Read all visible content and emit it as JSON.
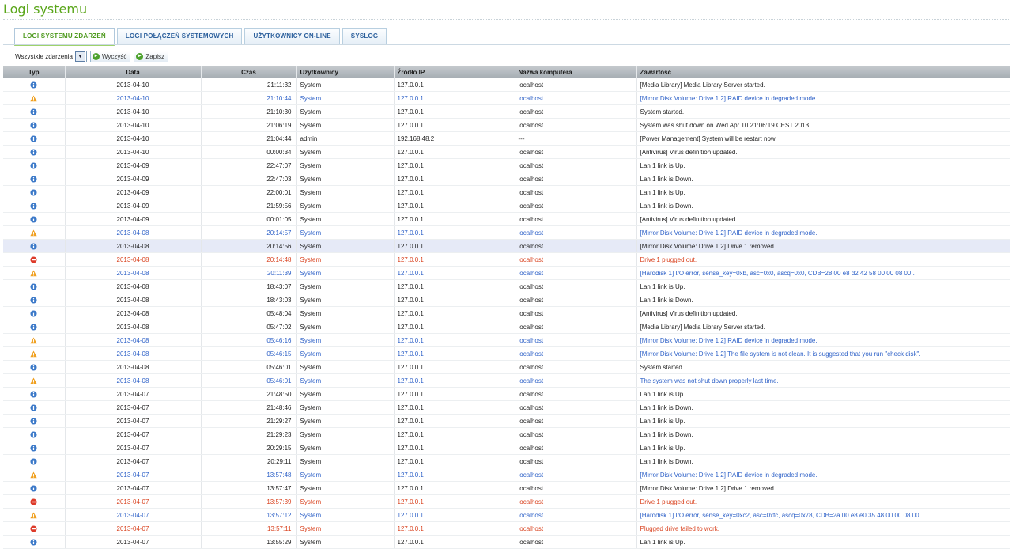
{
  "page": {
    "title": "Logi systemu"
  },
  "tabs": [
    {
      "label": "LOGI SYSTEMU ZDARZEŃ",
      "active": true
    },
    {
      "label": "LOGI POŁĄCZEŃ SYSTEMOWYCH",
      "active": false
    },
    {
      "label": "UŻYTKOWNICY ON-LINE",
      "active": false
    },
    {
      "label": "SYSLOG",
      "active": false
    }
  ],
  "toolbar": {
    "filter_value": "Wszystkie zdarzenia",
    "clear_label": "Wyczyść",
    "save_label": "Zapisz"
  },
  "table": {
    "columns": {
      "type": "Typ",
      "date": "Data",
      "time": "Czas",
      "users": "Użytkownicy",
      "source_ip": "Źródło IP",
      "computer": "Nazwa komputera",
      "content": "Zawartość"
    },
    "rows": [
      {
        "type": "info",
        "date": "2013-04-10",
        "time": "21:11:32",
        "user": "System",
        "ip": "127.0.0.1",
        "computer": "localhost",
        "content": "[Media Library] Media Library Server started."
      },
      {
        "type": "warning",
        "date": "2013-04-10",
        "time": "21:10:44",
        "user": "System",
        "ip": "127.0.0.1",
        "computer": "localhost",
        "content": "[Mirror Disk Volume: Drive 1 2] RAID device in degraded mode."
      },
      {
        "type": "info",
        "date": "2013-04-10",
        "time": "21:10:30",
        "user": "System",
        "ip": "127.0.0.1",
        "computer": "localhost",
        "content": "System started."
      },
      {
        "type": "info",
        "date": "2013-04-10",
        "time": "21:06:19",
        "user": "System",
        "ip": "127.0.0.1",
        "computer": "localhost",
        "content": "System was shut down on Wed Apr 10 21:06:19 CEST 2013."
      },
      {
        "type": "info",
        "date": "2013-04-10",
        "time": "21:04:44",
        "user": "admin",
        "ip": "192.168.48.2",
        "computer": "---",
        "content": "[Power Management] System will be restart now."
      },
      {
        "type": "info",
        "date": "2013-04-10",
        "time": "00:00:34",
        "user": "System",
        "ip": "127.0.0.1",
        "computer": "localhost",
        "content": "[Antivirus] Virus definition updated."
      },
      {
        "type": "info",
        "date": "2013-04-09",
        "time": "22:47:07",
        "user": "System",
        "ip": "127.0.0.1",
        "computer": "localhost",
        "content": "Lan 1 link is Up."
      },
      {
        "type": "info",
        "date": "2013-04-09",
        "time": "22:47:03",
        "user": "System",
        "ip": "127.0.0.1",
        "computer": "localhost",
        "content": "Lan 1 link is Down."
      },
      {
        "type": "info",
        "date": "2013-04-09",
        "time": "22:00:01",
        "user": "System",
        "ip": "127.0.0.1",
        "computer": "localhost",
        "content": "Lan 1 link is Up."
      },
      {
        "type": "info",
        "date": "2013-04-09",
        "time": "21:59:56",
        "user": "System",
        "ip": "127.0.0.1",
        "computer": "localhost",
        "content": "Lan 1 link is Down."
      },
      {
        "type": "info",
        "date": "2013-04-09",
        "time": "00:01:05",
        "user": "System",
        "ip": "127.0.0.1",
        "computer": "localhost",
        "content": "[Antivirus] Virus definition updated."
      },
      {
        "type": "warning",
        "date": "2013-04-08",
        "time": "20:14:57",
        "user": "System",
        "ip": "127.0.0.1",
        "computer": "localhost",
        "content": "[Mirror Disk Volume: Drive 1 2] RAID device in degraded mode."
      },
      {
        "type": "info",
        "date": "2013-04-08",
        "time": "20:14:56",
        "user": "System",
        "ip": "127.0.0.1",
        "computer": "localhost",
        "content": "[Mirror Disk Volume: Drive 1 2] Drive 1 removed.",
        "selected": true
      },
      {
        "type": "error",
        "date": "2013-04-08",
        "time": "20:14:48",
        "user": "System",
        "ip": "127.0.0.1",
        "computer": "localhost",
        "content": "Drive 1 plugged out."
      },
      {
        "type": "warning",
        "date": "2013-04-08",
        "time": "20:11:39",
        "user": "System",
        "ip": "127.0.0.1",
        "computer": "localhost",
        "content": "[Harddisk 1] I/O error, sense_key=0xb, asc=0x0, ascq=0x0, CDB=28 00 e8 d2 42 58 00 00 08 00 ."
      },
      {
        "type": "info",
        "date": "2013-04-08",
        "time": "18:43:07",
        "user": "System",
        "ip": "127.0.0.1",
        "computer": "localhost",
        "content": "Lan 1 link is Up."
      },
      {
        "type": "info",
        "date": "2013-04-08",
        "time": "18:43:03",
        "user": "System",
        "ip": "127.0.0.1",
        "computer": "localhost",
        "content": "Lan 1 link is Down."
      },
      {
        "type": "info",
        "date": "2013-04-08",
        "time": "05:48:04",
        "user": "System",
        "ip": "127.0.0.1",
        "computer": "localhost",
        "content": "[Antivirus] Virus definition updated."
      },
      {
        "type": "info",
        "date": "2013-04-08",
        "time": "05:47:02",
        "user": "System",
        "ip": "127.0.0.1",
        "computer": "localhost",
        "content": "[Media Library] Media Library Server started."
      },
      {
        "type": "warning",
        "date": "2013-04-08",
        "time": "05:46:16",
        "user": "System",
        "ip": "127.0.0.1",
        "computer": "localhost",
        "content": "[Mirror Disk Volume: Drive 1 2] RAID device in degraded mode."
      },
      {
        "type": "warning",
        "date": "2013-04-08",
        "time": "05:46:15",
        "user": "System",
        "ip": "127.0.0.1",
        "computer": "localhost",
        "content": "[Mirror Disk Volume: Drive 1 2] The file system is not clean. It is suggested that you run \"check disk\"."
      },
      {
        "type": "info",
        "date": "2013-04-08",
        "time": "05:46:01",
        "user": "System",
        "ip": "127.0.0.1",
        "computer": "localhost",
        "content": "System started."
      },
      {
        "type": "warning",
        "date": "2013-04-08",
        "time": "05:46:01",
        "user": "System",
        "ip": "127.0.0.1",
        "computer": "localhost",
        "content": "The system was not shut down properly last time."
      },
      {
        "type": "info",
        "date": "2013-04-07",
        "time": "21:48:50",
        "user": "System",
        "ip": "127.0.0.1",
        "computer": "localhost",
        "content": "Lan 1 link is Up."
      },
      {
        "type": "info",
        "date": "2013-04-07",
        "time": "21:48:46",
        "user": "System",
        "ip": "127.0.0.1",
        "computer": "localhost",
        "content": "Lan 1 link is Down."
      },
      {
        "type": "info",
        "date": "2013-04-07",
        "time": "21:29:27",
        "user": "System",
        "ip": "127.0.0.1",
        "computer": "localhost",
        "content": "Lan 1 link is Up."
      },
      {
        "type": "info",
        "date": "2013-04-07",
        "time": "21:29:23",
        "user": "System",
        "ip": "127.0.0.1",
        "computer": "localhost",
        "content": "Lan 1 link is Down."
      },
      {
        "type": "info",
        "date": "2013-04-07",
        "time": "20:29:15",
        "user": "System",
        "ip": "127.0.0.1",
        "computer": "localhost",
        "content": "Lan 1 link is Up."
      },
      {
        "type": "info",
        "date": "2013-04-07",
        "time": "20:29:11",
        "user": "System",
        "ip": "127.0.0.1",
        "computer": "localhost",
        "content": "Lan 1 link is Down."
      },
      {
        "type": "warning",
        "date": "2013-04-07",
        "time": "13:57:48",
        "user": "System",
        "ip": "127.0.0.1",
        "computer": "localhost",
        "content": "[Mirror Disk Volume: Drive 1 2] RAID device in degraded mode."
      },
      {
        "type": "info",
        "date": "2013-04-07",
        "time": "13:57:47",
        "user": "System",
        "ip": "127.0.0.1",
        "computer": "localhost",
        "content": "[Mirror Disk Volume: Drive 1 2] Drive 1 removed."
      },
      {
        "type": "error",
        "date": "2013-04-07",
        "time": "13:57:39",
        "user": "System",
        "ip": "127.0.0.1",
        "computer": "localhost",
        "content": "Drive 1 plugged out."
      },
      {
        "type": "warning",
        "date": "2013-04-07",
        "time": "13:57:12",
        "user": "System",
        "ip": "127.0.0.1",
        "computer": "localhost",
        "content": "[Harddisk 1] I/O error, sense_key=0xc2, asc=0xfc, ascq=0x78, CDB=2a 00 e8 e0 35 48 00 00 08 00 ."
      },
      {
        "type": "error",
        "date": "2013-04-07",
        "time": "13:57:11",
        "user": "System",
        "ip": "127.0.0.1",
        "computer": "localhost",
        "content": "Plugged drive failed to work."
      },
      {
        "type": "info",
        "date": "2013-04-07",
        "time": "13:55:29",
        "user": "System",
        "ip": "127.0.0.1",
        "computer": "localhost",
        "content": "Lan 1 link is Up."
      }
    ]
  },
  "icon_names": {
    "info": "info-icon",
    "warning": "warning-icon",
    "error": "error-icon"
  },
  "colors": {
    "title_green": "#5aa61a",
    "warning_text": "#2f62c8",
    "error_text": "#d94320",
    "info_icon": "#3a78c8",
    "warning_icon": "#f0a020",
    "error_icon": "#dd3a2a",
    "selected_row": "#e6eaf7"
  }
}
